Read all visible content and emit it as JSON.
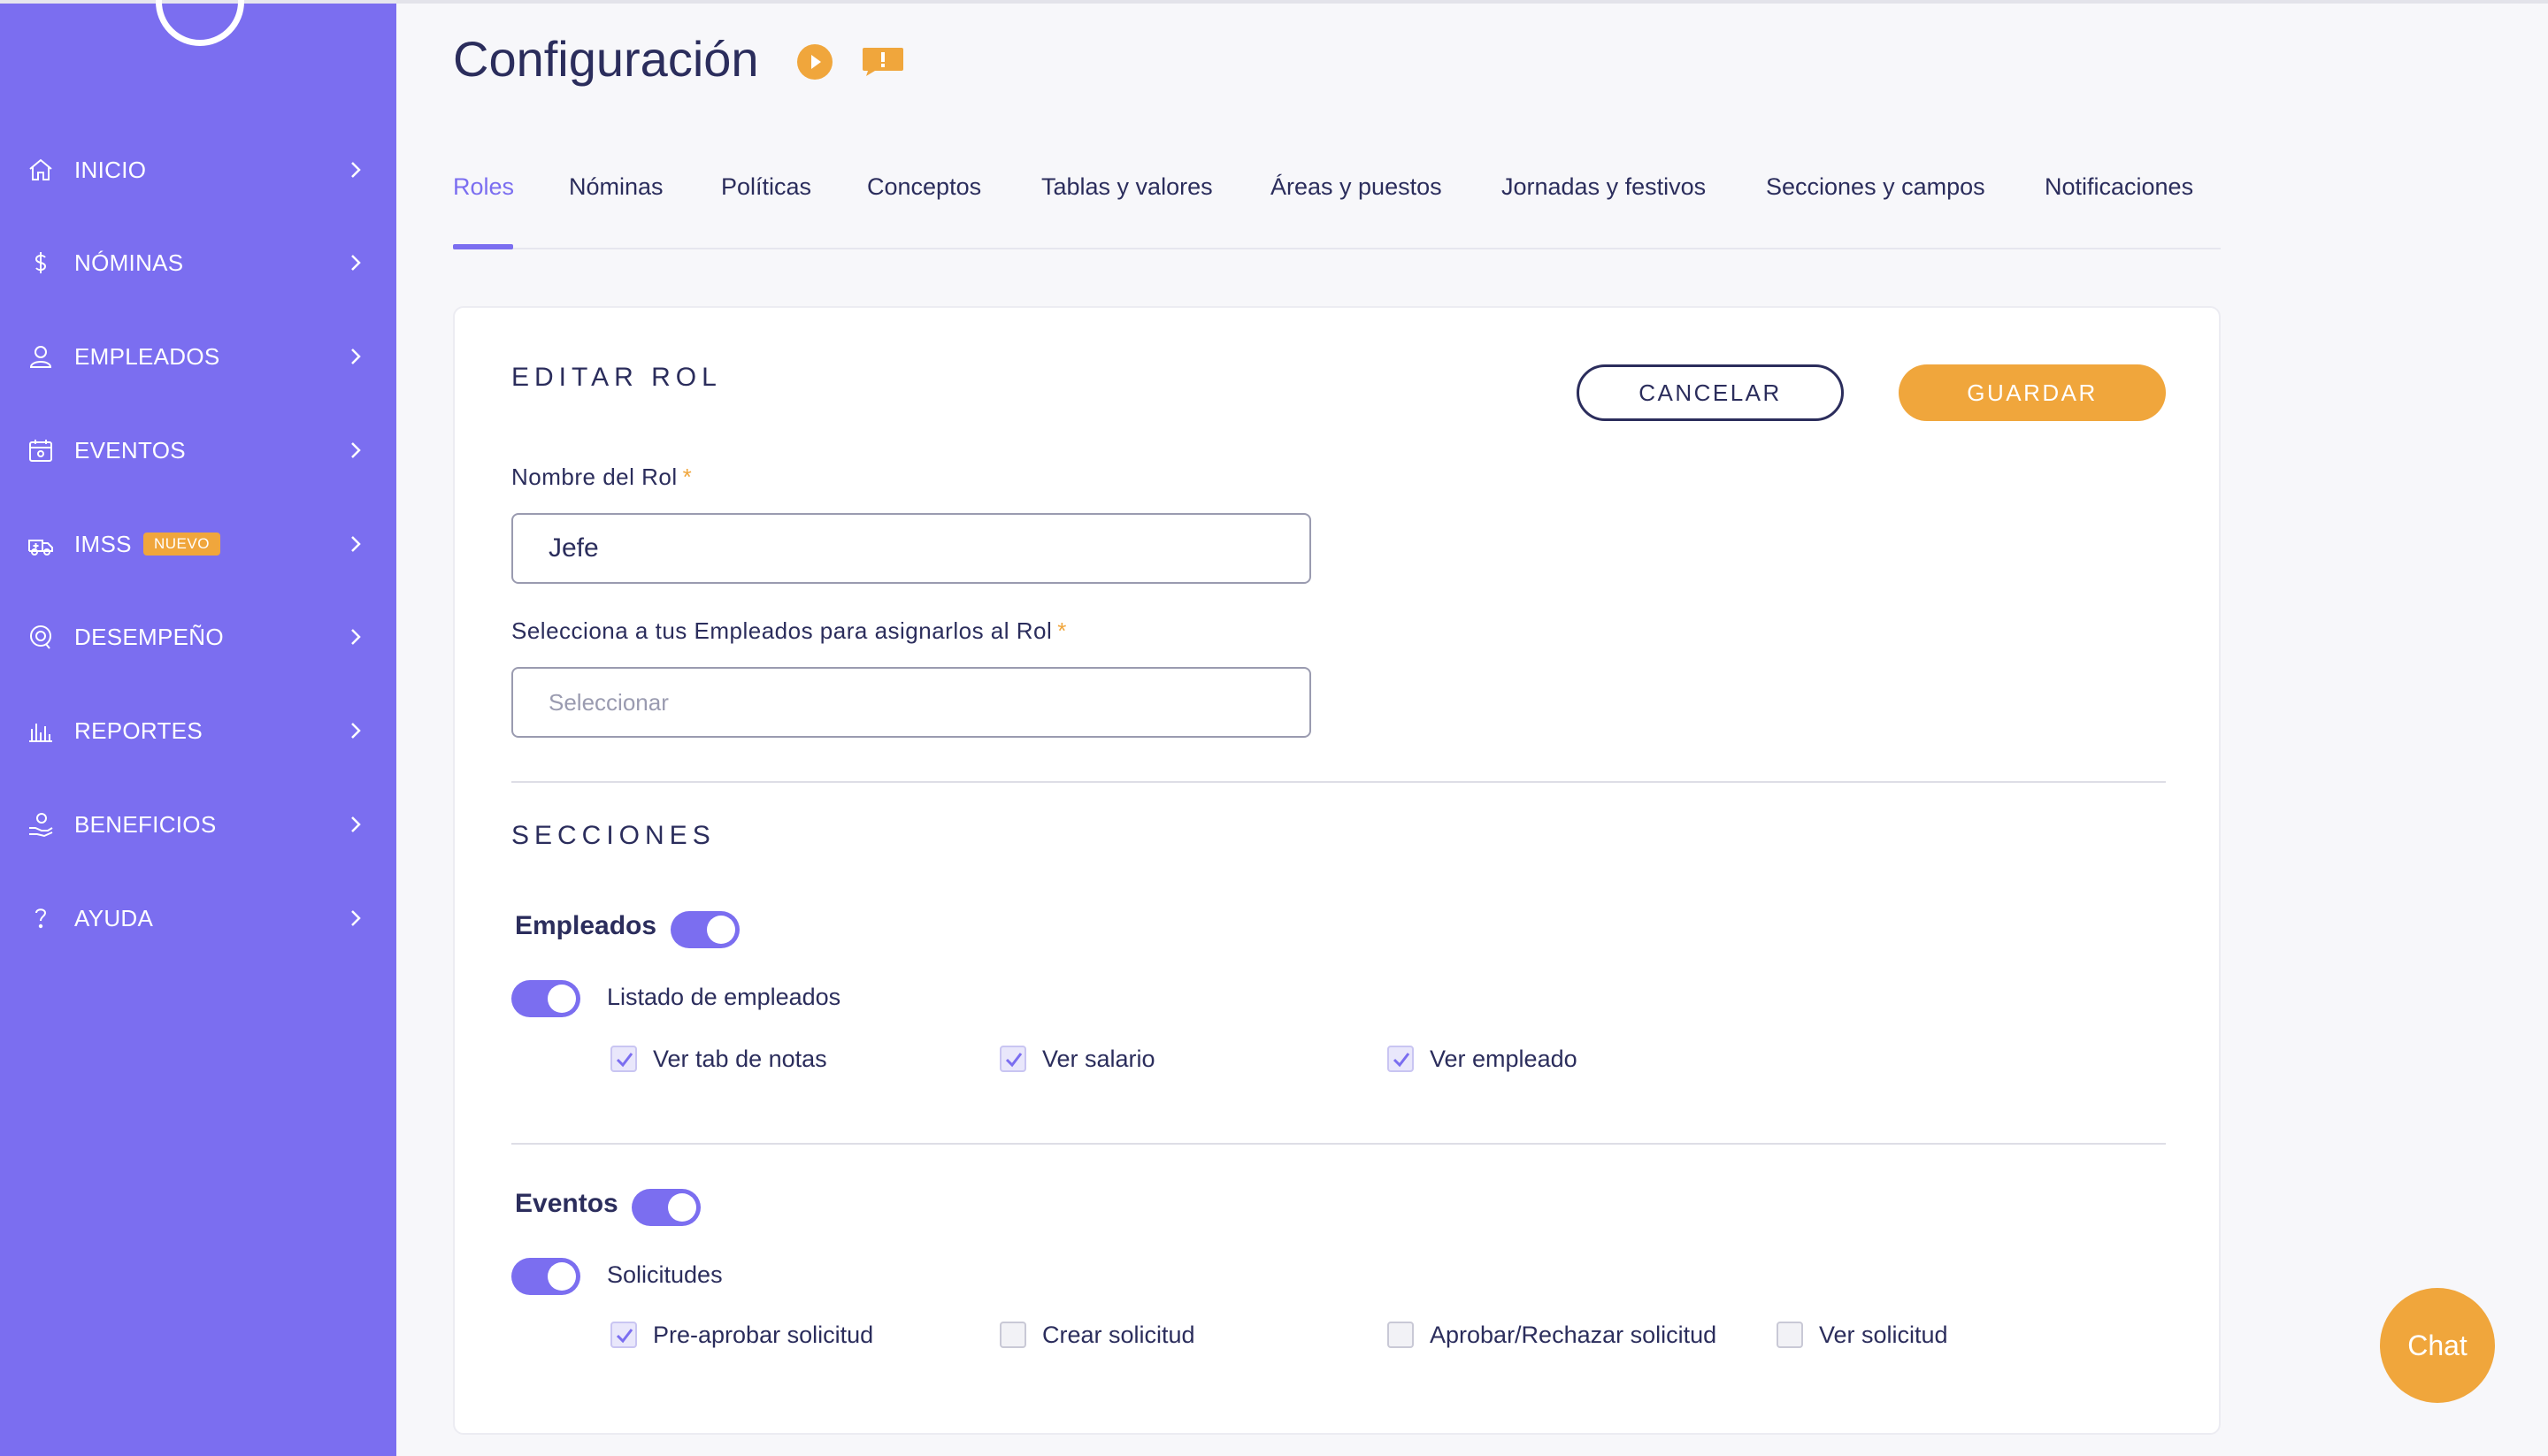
{
  "sidebar": {
    "items": [
      {
        "label": "INICIO",
        "icon": "home-icon"
      },
      {
        "label": "NÓMINAS",
        "icon": "dollar-icon"
      },
      {
        "label": "EMPLEADOS",
        "icon": "user-icon"
      },
      {
        "label": "EVENTOS",
        "icon": "calendar-icon"
      },
      {
        "label": "IMSS",
        "icon": "ambulance-icon",
        "badge": "NUEVO"
      },
      {
        "label": "DESEMPEÑO",
        "icon": "target-icon"
      },
      {
        "label": "REPORTES",
        "icon": "bar-chart-icon"
      },
      {
        "label": "BENEFICIOS",
        "icon": "benefit-hand-icon"
      },
      {
        "label": "AYUDA",
        "icon": "question-icon"
      }
    ]
  },
  "header": {
    "title": "Configuración"
  },
  "tabs": [
    {
      "label": "Roles",
      "active": true
    },
    {
      "label": "Nóminas"
    },
    {
      "label": "Políticas"
    },
    {
      "label": "Conceptos"
    },
    {
      "label": "Tablas y valores"
    },
    {
      "label": "Áreas y puestos"
    },
    {
      "label": "Jornadas y festivos"
    },
    {
      "label": "Secciones y campos"
    },
    {
      "label": "Notificaciones"
    }
  ],
  "form": {
    "title": "EDITAR ROL",
    "cancel_label": "CANCELAR",
    "save_label": "GUARDAR",
    "role_name_label": "Nombre del Rol",
    "role_name_value": "Jefe",
    "employees_label": "Selecciona a tus Empleados para asignarlos al Rol",
    "employees_placeholder": "Seleccionar",
    "required_mark": "*"
  },
  "sections": {
    "title": "SECCIONES",
    "groups": [
      {
        "title": "Empleados",
        "enabled": true,
        "sub": {
          "label": "Listado de empleados",
          "enabled": true,
          "options": [
            {
              "label": "Ver tab de notas",
              "checked": true
            },
            {
              "label": "Ver salario",
              "checked": true
            },
            {
              "label": "Ver empleado",
              "checked": true
            }
          ]
        }
      },
      {
        "title": "Eventos",
        "enabled": true,
        "sub": {
          "label": "Solicitudes",
          "enabled": true,
          "options": [
            {
              "label": "Pre-aprobar solicitud",
              "checked": true
            },
            {
              "label": "Crear solicitud",
              "checked": false
            },
            {
              "label": "Aprobar/Rechazar solicitud",
              "checked": false
            },
            {
              "label": "Ver solicitud",
              "checked": false
            }
          ]
        }
      }
    ]
  },
  "chat": {
    "label": "Chat"
  },
  "colors": {
    "sidebar": "#7b6ef0",
    "accent": "#7b6ef0",
    "orange": "#f0a63c",
    "text": "#2b2d5c"
  }
}
